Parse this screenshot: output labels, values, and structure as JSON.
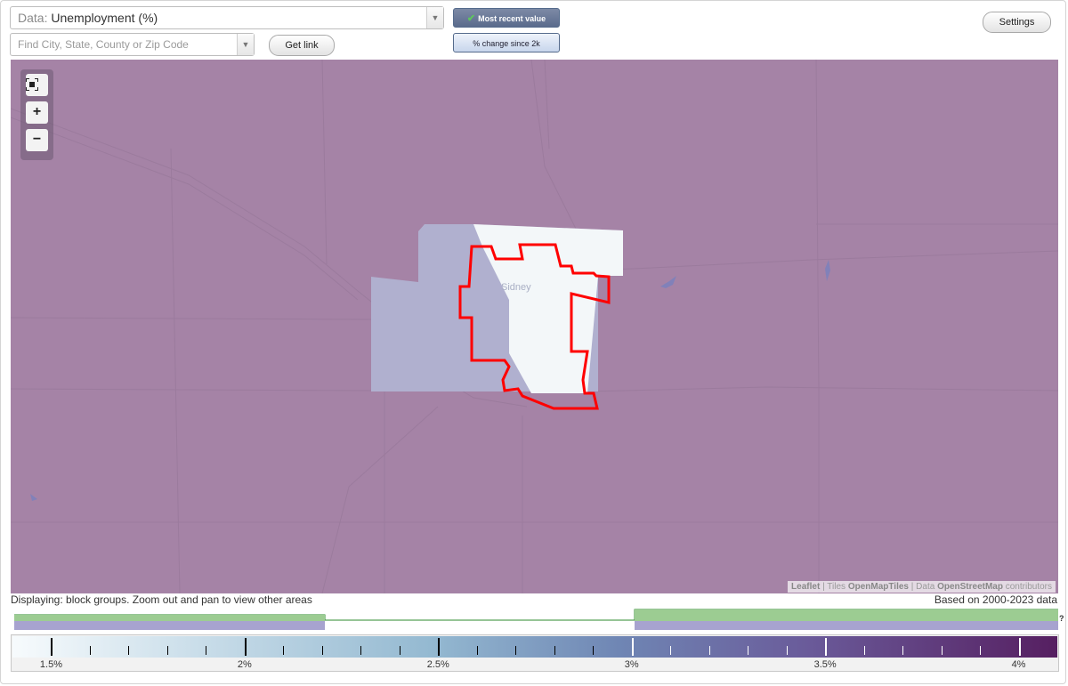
{
  "data_select": {
    "prefix": "Data:",
    "value": "Unemployment (%)"
  },
  "search": {
    "placeholder": "Find City, State, County or Zip Code"
  },
  "buttons": {
    "get_link": "Get link",
    "settings": "Settings"
  },
  "toggles": {
    "most_recent": "Most recent value",
    "change_since": "% change since 2k"
  },
  "map": {
    "place_label": "Sidney",
    "attribution": {
      "leaflet": "Leaflet",
      "sep": "|",
      "tiles": "Tiles",
      "tiles_source": "OpenMapTiles",
      "data": "Data",
      "osm": "OpenStreetMap",
      "contributors": "contributors"
    },
    "colors": {
      "background": "#a583a6",
      "light_area": "#f3f7f9",
      "mid_area": "#b0b0cf",
      "outline": "#ff0000"
    }
  },
  "status": {
    "displaying": "Displaying: block groups. Zoom out and pan to view other areas",
    "based_on": "Based on 2000-2023 data"
  },
  "legend": {
    "ticks": [
      {
        "value": 1.5,
        "label": "1.5%"
      },
      {
        "value": 2,
        "label": "2%"
      },
      {
        "value": 2.5,
        "label": "2.5%"
      },
      {
        "value": 3,
        "label": "3%"
      },
      {
        "value": 3.5,
        "label": "3.5%"
      },
      {
        "value": 4,
        "label": "4%"
      }
    ],
    "min": 1.4,
    "max": 4.1,
    "histogram_help": "?"
  },
  "icons": [
    "checkmark-icon",
    "fullscreen-icon",
    "zoom-in-icon",
    "zoom-out-icon",
    "chevron-down-icon"
  ]
}
